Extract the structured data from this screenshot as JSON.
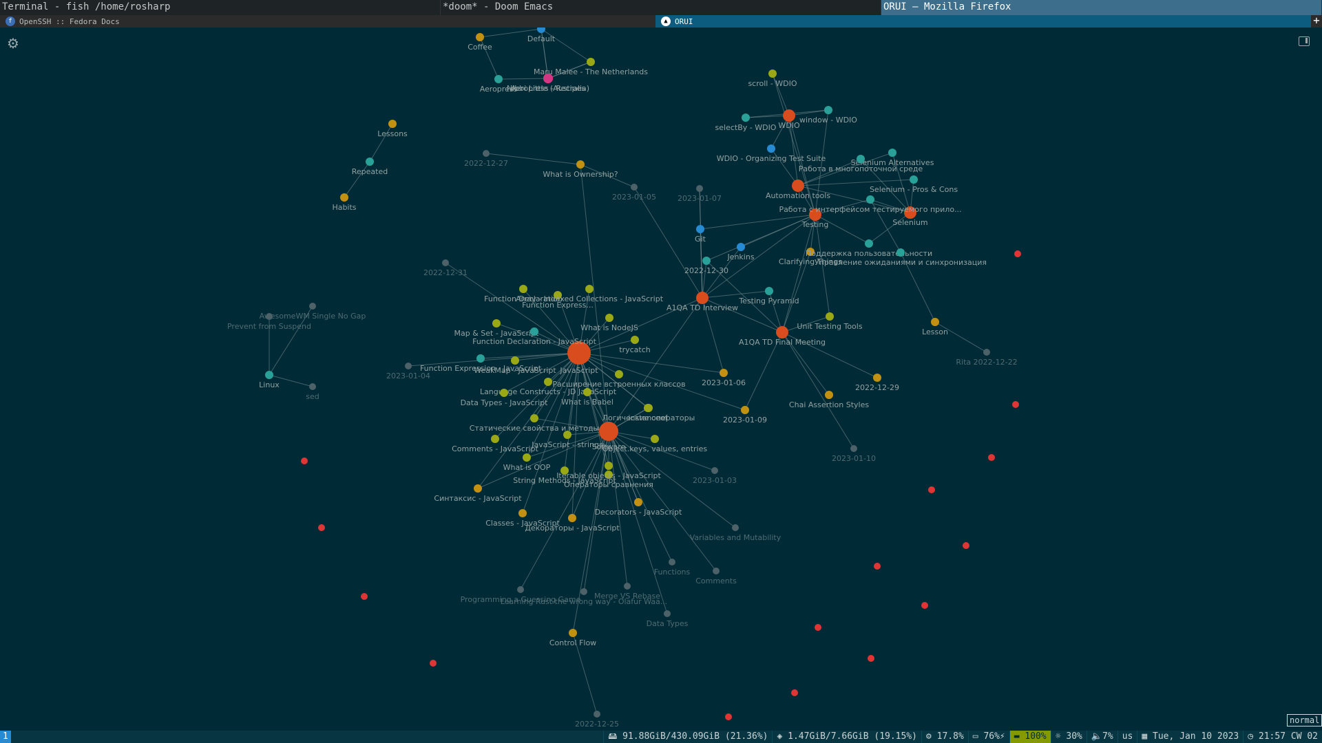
{
  "window_titles": [
    "Terminal - fish /home/rosharp",
    "*doom* - Doom Emacs",
    "ORUI — Mozilla Firefox"
  ],
  "tabs": [
    {
      "label": "OpenSSH :: Fedora Docs",
      "icon": "fedora-icon"
    },
    {
      "label": "ORUI",
      "icon": "orui-icon"
    }
  ],
  "mode_indicator": "normal",
  "colors": {
    "background": "#002b36",
    "hub": "#d84c1e",
    "teal": "#2aa198",
    "olive": "#9aa816",
    "gold": "#c29112",
    "blue": "#268bd2",
    "magenta": "#d33682",
    "gray": "#4d6168",
    "red": "#e03535",
    "edge": "#7a8e94"
  },
  "graph": {
    "nodes": [
      {
        "id": "default",
        "label": "Default",
        "type": "blue"
      },
      {
        "id": "coffee",
        "label": "Coffee",
        "type": "gold"
      },
      {
        "id": "maru",
        "label": "Maru Malee - The Netherlands",
        "type": "olive"
      },
      {
        "id": "aeropress",
        "label": "Aeropress",
        "type": "teal"
      },
      {
        "id": "nibbi",
        "label": "Nibbi Little (Australia)",
        "type": "magenta"
      },
      {
        "id": "aerorecipes",
        "label": "Aeropress - Recipes",
        "type": "magenta"
      },
      {
        "id": "lessons",
        "label": "Lessons",
        "type": "gold"
      },
      {
        "id": "repeated",
        "label": "Repeated",
        "type": "teal"
      },
      {
        "id": "habits",
        "label": "Habits",
        "type": "gold"
      },
      {
        "id": "d1227",
        "label": "2022-12-27",
        "type": "gray"
      },
      {
        "id": "ownership",
        "label": "What is Ownership?",
        "type": "gold"
      },
      {
        "id": "d0105",
        "label": "2023-01-05",
        "type": "gray"
      },
      {
        "id": "d0107",
        "label": "2023-01-07",
        "type": "gray"
      },
      {
        "id": "scroll",
        "label": "scroll - WDIO",
        "type": "olive"
      },
      {
        "id": "wdio",
        "label": "WDIO",
        "type": "hub"
      },
      {
        "id": "window",
        "label": "window - WDIO",
        "type": "teal"
      },
      {
        "id": "selectby",
        "label": "selectBy - WDIO",
        "type": "teal"
      },
      {
        "id": "organizing",
        "label": "WDIO - Organizing Test Suite",
        "type": "blue"
      },
      {
        "id": "selalt",
        "label": "Selenium Alternatives",
        "type": "teal"
      },
      {
        "id": "multithread",
        "label": "Работа в многопоточной среде",
        "type": "teal"
      },
      {
        "id": "selpros",
        "label": "Selenium - Pros & Cons",
        "type": "teal"
      },
      {
        "id": "autotools",
        "label": "Automation tools",
        "type": "hub"
      },
      {
        "id": "testing",
        "label": "Testing",
        "type": "hub"
      },
      {
        "id": "selenium",
        "label": "Selenium",
        "type": "hub"
      },
      {
        "id": "interface",
        "label": "Работа с интерфейсом тестируемого прило...",
        "type": "teal"
      },
      {
        "id": "git",
        "label": "Git",
        "type": "blue"
      },
      {
        "id": "jenkins",
        "label": "Jenkins",
        "type": "blue"
      },
      {
        "id": "d1230",
        "label": "2022-12-30",
        "type": "teal"
      },
      {
        "id": "clarifying",
        "label": "Clarifying Things",
        "type": "gold"
      },
      {
        "id": "support",
        "label": "Поддержка пользовательности",
        "type": "teal"
      },
      {
        "id": "waits",
        "label": "Управление ожиданиями и синхронизация",
        "type": "teal"
      },
      {
        "id": "d1231",
        "label": "2022-12-31",
        "type": "gray"
      },
      {
        "id": "testpyramid",
        "label": "Testing Pyramid",
        "type": "teal"
      },
      {
        "id": "a1qatd",
        "label": "A1QA TD Interview",
        "type": "hub"
      },
      {
        "id": "a1qafinal",
        "label": "A1QA TD Final Meeting",
        "type": "hub"
      },
      {
        "id": "unittools",
        "label": "Unit Testing Tools",
        "type": "olive"
      },
      {
        "id": "lesson",
        "label": "Lesson",
        "type": "gold"
      },
      {
        "id": "rita",
        "label": "Rita 2022-12-22",
        "type": "gray"
      },
      {
        "id": "awesomewm",
        "label": "AwesomeWM Single No Gap",
        "type": "gray"
      },
      {
        "id": "suspend",
        "label": "Prevent from Suspend",
        "type": "gray"
      },
      {
        "id": "linux",
        "label": "Linux",
        "type": "teal"
      },
      {
        "id": "sed",
        "label": "sed",
        "type": "gray"
      },
      {
        "id": "js",
        "label": "JavaScript",
        "type": "hub"
      },
      {
        "id": "fdecl",
        "label": "Function Declaration",
        "type": "olive"
      },
      {
        "id": "fexpr",
        "label": "Function Express...",
        "type": "olive"
      },
      {
        "id": "array",
        "label": "Array - Indexed Collections - JavaScript",
        "type": "olive"
      },
      {
        "id": "mapset",
        "label": "Map & Set - JavaScript",
        "type": "olive"
      },
      {
        "id": "fdecljs",
        "label": "Function Declaration - JavaScript",
        "type": "teal"
      },
      {
        "id": "nodejs",
        "label": "What is NodeJS",
        "type": "olive"
      },
      {
        "id": "trycatch",
        "label": "trycatch",
        "type": "olive"
      },
      {
        "id": "d0104",
        "label": "2023-01-04",
        "type": "gray"
      },
      {
        "id": "fexprjs",
        "label": "Function Expression - JavaScript",
        "type": "teal"
      },
      {
        "id": "weakmap",
        "label": "WeakMap - JavaScript",
        "type": "olive"
      },
      {
        "id": "langconst",
        "label": "Language Constructs - JD JavaScript",
        "type": "olive"
      },
      {
        "id": "builtin",
        "label": "Расширение встроенных классов",
        "type": "olive"
      },
      {
        "id": "babel",
        "label": "What is Babel",
        "type": "olive"
      },
      {
        "id": "d0106",
        "label": "2023-01-06",
        "type": "gold"
      },
      {
        "id": "datatypesjs",
        "label": "Data Types - JavaScript",
        "type": "olive"
      },
      {
        "id": "logicops",
        "label": "Логические операторы",
        "type": "olive"
      },
      {
        "id": "instanceof",
        "label": "instanceof",
        "type": "olive"
      },
      {
        "id": "static",
        "label": "Статические свойства и методы",
        "type": "olive"
      },
      {
        "id": "jsstrings",
        "label": "JavaScript - strings",
        "type": "olive"
      },
      {
        "id": "software",
        "label": "Software",
        "type": "hub"
      },
      {
        "id": "d0109",
        "label": "2023-01-09",
        "type": "gold"
      },
      {
        "id": "comments_js",
        "label": "Comments - JavaScript",
        "type": "olive"
      },
      {
        "id": "oop",
        "label": "What is OOP",
        "type": "olive"
      },
      {
        "id": "objkeys",
        "label": "Object.keys, values, entries",
        "type": "olive"
      },
      {
        "id": "strmethods",
        "label": "String Methods - JavaScript",
        "type": "olive"
      },
      {
        "id": "compareops",
        "label": "Операторы сравнения",
        "type": "olive"
      },
      {
        "id": "iterables",
        "label": "Iterable objects - JavaScript",
        "type": "olive"
      },
      {
        "id": "d0103",
        "label": "2023-01-03",
        "type": "gray"
      },
      {
        "id": "syntax",
        "label": "Синтаксис - JavaScript",
        "type": "gold"
      },
      {
        "id": "decorators",
        "label": "Decorators - JavaScript",
        "type": "gold"
      },
      {
        "id": "classes",
        "label": "Classes - JavaScript",
        "type": "gold"
      },
      {
        "id": "decorru",
        "label": "Декораторы - JavaScript",
        "type": "gold"
      },
      {
        "id": "varsmut",
        "label": "Variables and Mutability",
        "type": "gray"
      },
      {
        "id": "functions",
        "label": "Functions",
        "type": "gray"
      },
      {
        "id": "comments",
        "label": "Comments",
        "type": "gray"
      },
      {
        "id": "guessing",
        "label": "Programming a Guessing Game",
        "type": "gray"
      },
      {
        "id": "rustwrong",
        "label": "Learning Rust the wrong way - Olafur Waa...",
        "type": "gray"
      },
      {
        "id": "merge",
        "label": "Merge VS Rebase",
        "type": "gray"
      },
      {
        "id": "datatypes",
        "label": "Data Types",
        "type": "gray"
      },
      {
        "id": "controlflow",
        "label": "Control Flow",
        "type": "gold"
      },
      {
        "id": "d1225",
        "label": "2022-12-25",
        "type": "gray"
      },
      {
        "id": "chai",
        "label": "Chai Assertion Styles",
        "type": "gold"
      },
      {
        "id": "d1229",
        "label": "2022-12-29",
        "type": "gold"
      },
      {
        "id": "d0110",
        "label": "2023-01-10",
        "type": "gray"
      }
    ],
    "edges": [
      [
        "default",
        "coffee"
      ],
      [
        "default",
        "maru"
      ],
      [
        "default",
        "aerorecipes"
      ],
      [
        "default",
        "nibbi"
      ],
      [
        "coffee",
        "aeropress"
      ],
      [
        "aeropress",
        "aerorecipes"
      ],
      [
        "nibbi",
        "maru"
      ],
      [
        "aerorecipes",
        "maru"
      ],
      [
        "lessons",
        "repeated"
      ],
      [
        "repeated",
        "habits"
      ],
      [
        "d1227",
        "ownership"
      ],
      [
        "ownership",
        "d0105"
      ],
      [
        "d0105",
        "a1qatd"
      ],
      [
        "d0107",
        "a1qatd"
      ],
      [
        "scroll",
        "wdio"
      ],
      [
        "wdio",
        "window"
      ],
      [
        "wdio",
        "selectby"
      ],
      [
        "selectby",
        "window"
      ],
      [
        "wdio",
        "organizing"
      ],
      [
        "wdio",
        "autotools"
      ],
      [
        "wdio",
        "testing"
      ],
      [
        "organizing",
        "autotools"
      ],
      [
        "autotools",
        "testing"
      ],
      [
        "autotools",
        "selalt"
      ],
      [
        "autotools",
        "multithread"
      ],
      [
        "autotools",
        "selpros"
      ],
      [
        "autotools",
        "selenium"
      ],
      [
        "selenium",
        "selalt"
      ],
      [
        "selenium",
        "selpros"
      ],
      [
        "selenium",
        "multithread"
      ],
      [
        "selenium",
        "interface"
      ],
      [
        "selenium",
        "support"
      ],
      [
        "testing",
        "interface"
      ],
      [
        "testing",
        "git"
      ],
      [
        "testing",
        "jenkins"
      ],
      [
        "testing",
        "d1230"
      ],
      [
        "testing",
        "clarifying"
      ],
      [
        "testing",
        "support"
      ],
      [
        "testing",
        "a1qatd"
      ],
      [
        "testing",
        "a1qafinal"
      ],
      [
        "testing",
        "unittools"
      ],
      [
        "scroll",
        "testing"
      ],
      [
        "window",
        "testing"
      ],
      [
        "a1qatd",
        "git"
      ],
      [
        "a1qatd",
        "jenkins"
      ],
      [
        "a1qatd",
        "d1230"
      ],
      [
        "a1qatd",
        "testpyramid"
      ],
      [
        "a1qatd",
        "a1qafinal"
      ],
      [
        "a1qatd",
        "d0106"
      ],
      [
        "a1qatd",
        "d0107"
      ],
      [
        "a1qafinal",
        "unittools"
      ],
      [
        "a1qafinal",
        "clarifying"
      ],
      [
        "a1qafinal",
        "d1229"
      ],
      [
        "a1qafinal",
        "chai"
      ],
      [
        "a1qafinal",
        "d0109"
      ],
      [
        "a1qafinal",
        "d0110"
      ],
      [
        "a1qafinal",
        "testpyramid"
      ],
      [
        "a1qafinal",
        "d1230"
      ],
      [
        "lesson",
        "waits"
      ],
      [
        "lesson",
        "rita"
      ],
      [
        "waits",
        "interface"
      ],
      [
        "awesomewm",
        "linux"
      ],
      [
        "suspend",
        "linux"
      ],
      [
        "linux",
        "sed"
      ],
      [
        "d1231",
        "js"
      ],
      [
        "d0104",
        "js"
      ],
      [
        "d0106",
        "js"
      ],
      [
        "d0109",
        "js"
      ],
      [
        "js",
        "fdecl"
      ],
      [
        "js",
        "fexpr"
      ],
      [
        "js",
        "array"
      ],
      [
        "js",
        "mapset"
      ],
      [
        "js",
        "fdecljs"
      ],
      [
        "js",
        "nodejs"
      ],
      [
        "js",
        "trycatch"
      ],
      [
        "js",
        "fexprjs"
      ],
      [
        "js",
        "weakmap"
      ],
      [
        "js",
        "langconst"
      ],
      [
        "js",
        "builtin"
      ],
      [
        "js",
        "babel"
      ],
      [
        "js",
        "datatypesjs"
      ],
      [
        "js",
        "logicops"
      ],
      [
        "js",
        "instanceof"
      ],
      [
        "js",
        "static"
      ],
      [
        "js",
        "jsstrings"
      ],
      [
        "js",
        "software"
      ],
      [
        "js",
        "comments_js"
      ],
      [
        "js",
        "oop"
      ],
      [
        "js",
        "strmethods"
      ],
      [
        "js",
        "syntax"
      ],
      [
        "js",
        "classes"
      ],
      [
        "js",
        "decorru"
      ],
      [
        "js",
        "iterables"
      ],
      [
        "js",
        "decorators"
      ],
      [
        "js",
        "compareops"
      ],
      [
        "js",
        "a1qatd"
      ],
      [
        "software",
        "objkeys"
      ],
      [
        "software",
        "instanceof"
      ],
      [
        "software",
        "oop"
      ],
      [
        "software",
        "iterables"
      ],
      [
        "software",
        "d0103"
      ],
      [
        "software",
        "varsmut"
      ],
      [
        "software",
        "functions"
      ],
      [
        "software",
        "comments"
      ],
      [
        "software",
        "guessing"
      ],
      [
        "software",
        "rustwrong"
      ],
      [
        "software",
        "merge"
      ],
      [
        "software",
        "datatypes"
      ],
      [
        "software",
        "controlflow"
      ],
      [
        "software",
        "decorators"
      ],
      [
        "software",
        "jsstrings"
      ],
      [
        "software",
        "logicops"
      ],
      [
        "software",
        "syntax"
      ],
      [
        "software",
        "static"
      ],
      [
        "software",
        "babel"
      ],
      [
        "software",
        "decorru"
      ],
      [
        "software",
        "ownership"
      ],
      [
        "controlflow",
        "d1225"
      ],
      [
        "software",
        "a1qatd"
      ]
    ],
    "orphans": 16
  },
  "statusbar": {
    "workspace": "1",
    "disk": "91.88GiB/430.09GiB (21.36%)",
    "memory": "1.47GiB/7.66GiB (19.15%)",
    "cpu": "17.8%",
    "battery": "76%",
    "charging": "100%",
    "brightness": "30%",
    "volume": "7%",
    "layout": "us",
    "date": "Tue, Jan 10 2023",
    "time": "21:57 CW 02"
  }
}
